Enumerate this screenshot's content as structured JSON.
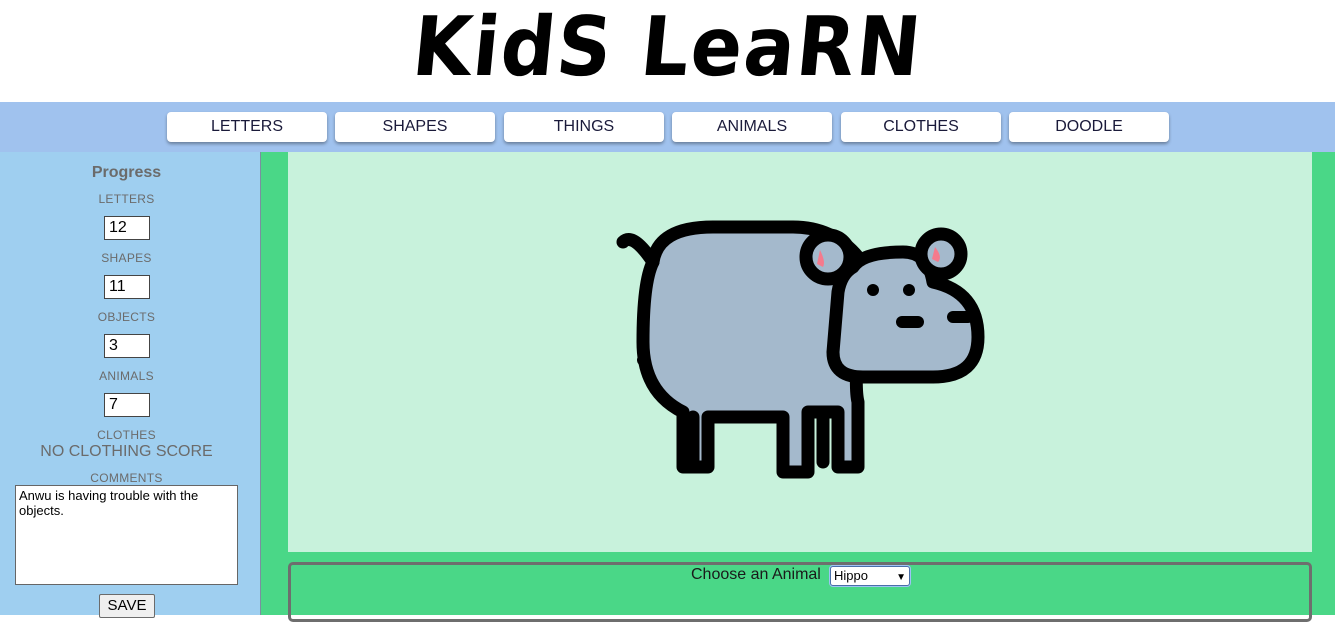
{
  "header": {
    "logo_text": "KidS LeaRN"
  },
  "nav": {
    "items": [
      "LETTERS",
      "SHAPES",
      "THINGS",
      "ANIMALS",
      "CLOTHES",
      "DOODLE"
    ]
  },
  "sidebar": {
    "title": "Progress",
    "letters_label": "LETTERS",
    "letters_value": "12",
    "shapes_label": "SHAPES",
    "shapes_value": "11",
    "objects_label": "OBJECTS",
    "objects_value": "3",
    "animals_label": "ANIMALS",
    "animals_value": "7",
    "clothes_label": "CLOTHES",
    "clothes_score": "NO CLOTHING SCORE",
    "comments_label": "COMMENTS",
    "comments_value": "Anwu is having trouble with the objects.",
    "save_label": "SAVE"
  },
  "main": {
    "animal_icon": "hippo-illustration",
    "chooser_label": "Choose an Animal",
    "selected_animal": "Hippo"
  },
  "colors": {
    "nav_bg": "#a0c2ee",
    "sidebar_bg": "#9fcff0",
    "main_bg": "#4ad787",
    "canvas_bg": "#c8f2dc",
    "hippo_body": "#a4b9cc",
    "hippo_ear": "#f57a8c"
  }
}
